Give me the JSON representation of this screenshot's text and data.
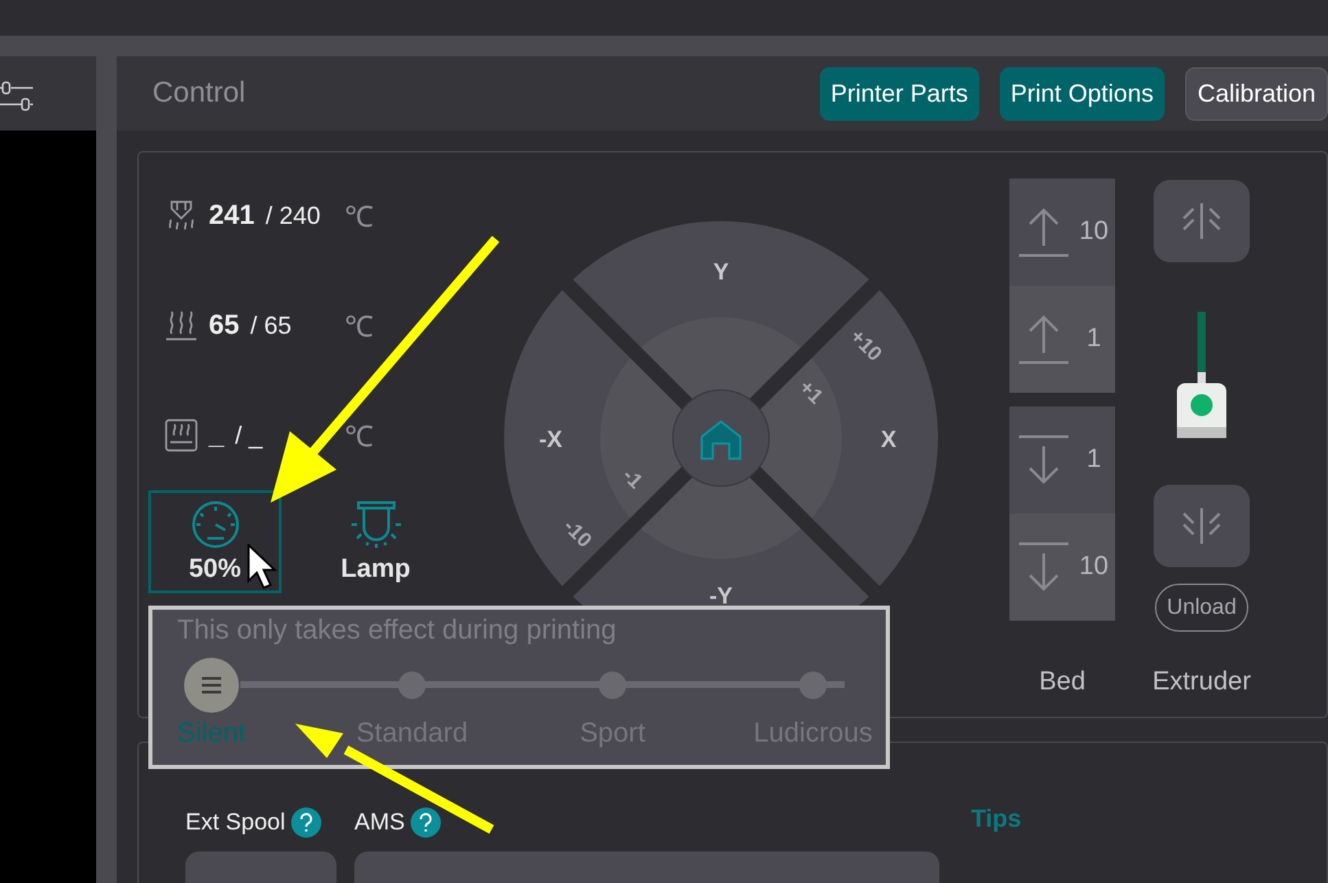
{
  "header": {
    "title": "Control",
    "buttons": [
      {
        "label": "Printer Parts",
        "kind": "accent"
      },
      {
        "label": "Print Options",
        "kind": "accent"
      },
      {
        "label": "Calibration",
        "kind": "plain"
      }
    ]
  },
  "temperatures": [
    {
      "kind": "nozzle",
      "current": "241",
      "target": "/ 240",
      "unit": "℃"
    },
    {
      "kind": "bed",
      "current": "65",
      "target": "/ 65",
      "unit": "℃"
    },
    {
      "kind": "chamber",
      "current": "_",
      "target": "/ _",
      "unit": "℃"
    }
  ],
  "speed": {
    "label": "50%",
    "selected": true
  },
  "lamp": {
    "label": "Lamp"
  },
  "jog": {
    "labels": [
      {
        "kind": "up",
        "text": "Y"
      },
      {
        "kind": "left",
        "text": "-X"
      },
      {
        "kind": "right",
        "text": "X"
      },
      {
        "kind": "down",
        "text": "-Y"
      },
      {
        "kind": "p10",
        "text": "+10"
      },
      {
        "kind": "p1",
        "text": "+1"
      },
      {
        "kind": "m1",
        "text": "-1"
      },
      {
        "kind": "m10",
        "text": "-10"
      }
    ]
  },
  "bed": {
    "label": "Bed",
    "buttons": [
      {
        "kind": "up",
        "step": "10"
      },
      {
        "kind": "up",
        "step": "1"
      },
      {
        "kind": "down",
        "step": "1"
      },
      {
        "kind": "down",
        "step": "10"
      }
    ]
  },
  "extruder": {
    "label": "Extruder",
    "unload": "Unload"
  },
  "speed_popup": {
    "note": "This only takes effect during printing",
    "levels": [
      {
        "label": "Silent",
        "selected": true
      },
      {
        "label": "Standard",
        "selected": false
      },
      {
        "label": "Sport",
        "selected": false
      },
      {
        "label": "Ludicrous",
        "selected": false
      }
    ]
  },
  "filament": {
    "sources": [
      {
        "label": "Ext Spool"
      },
      {
        "label": "AMS"
      }
    ],
    "tips": "Tips"
  }
}
